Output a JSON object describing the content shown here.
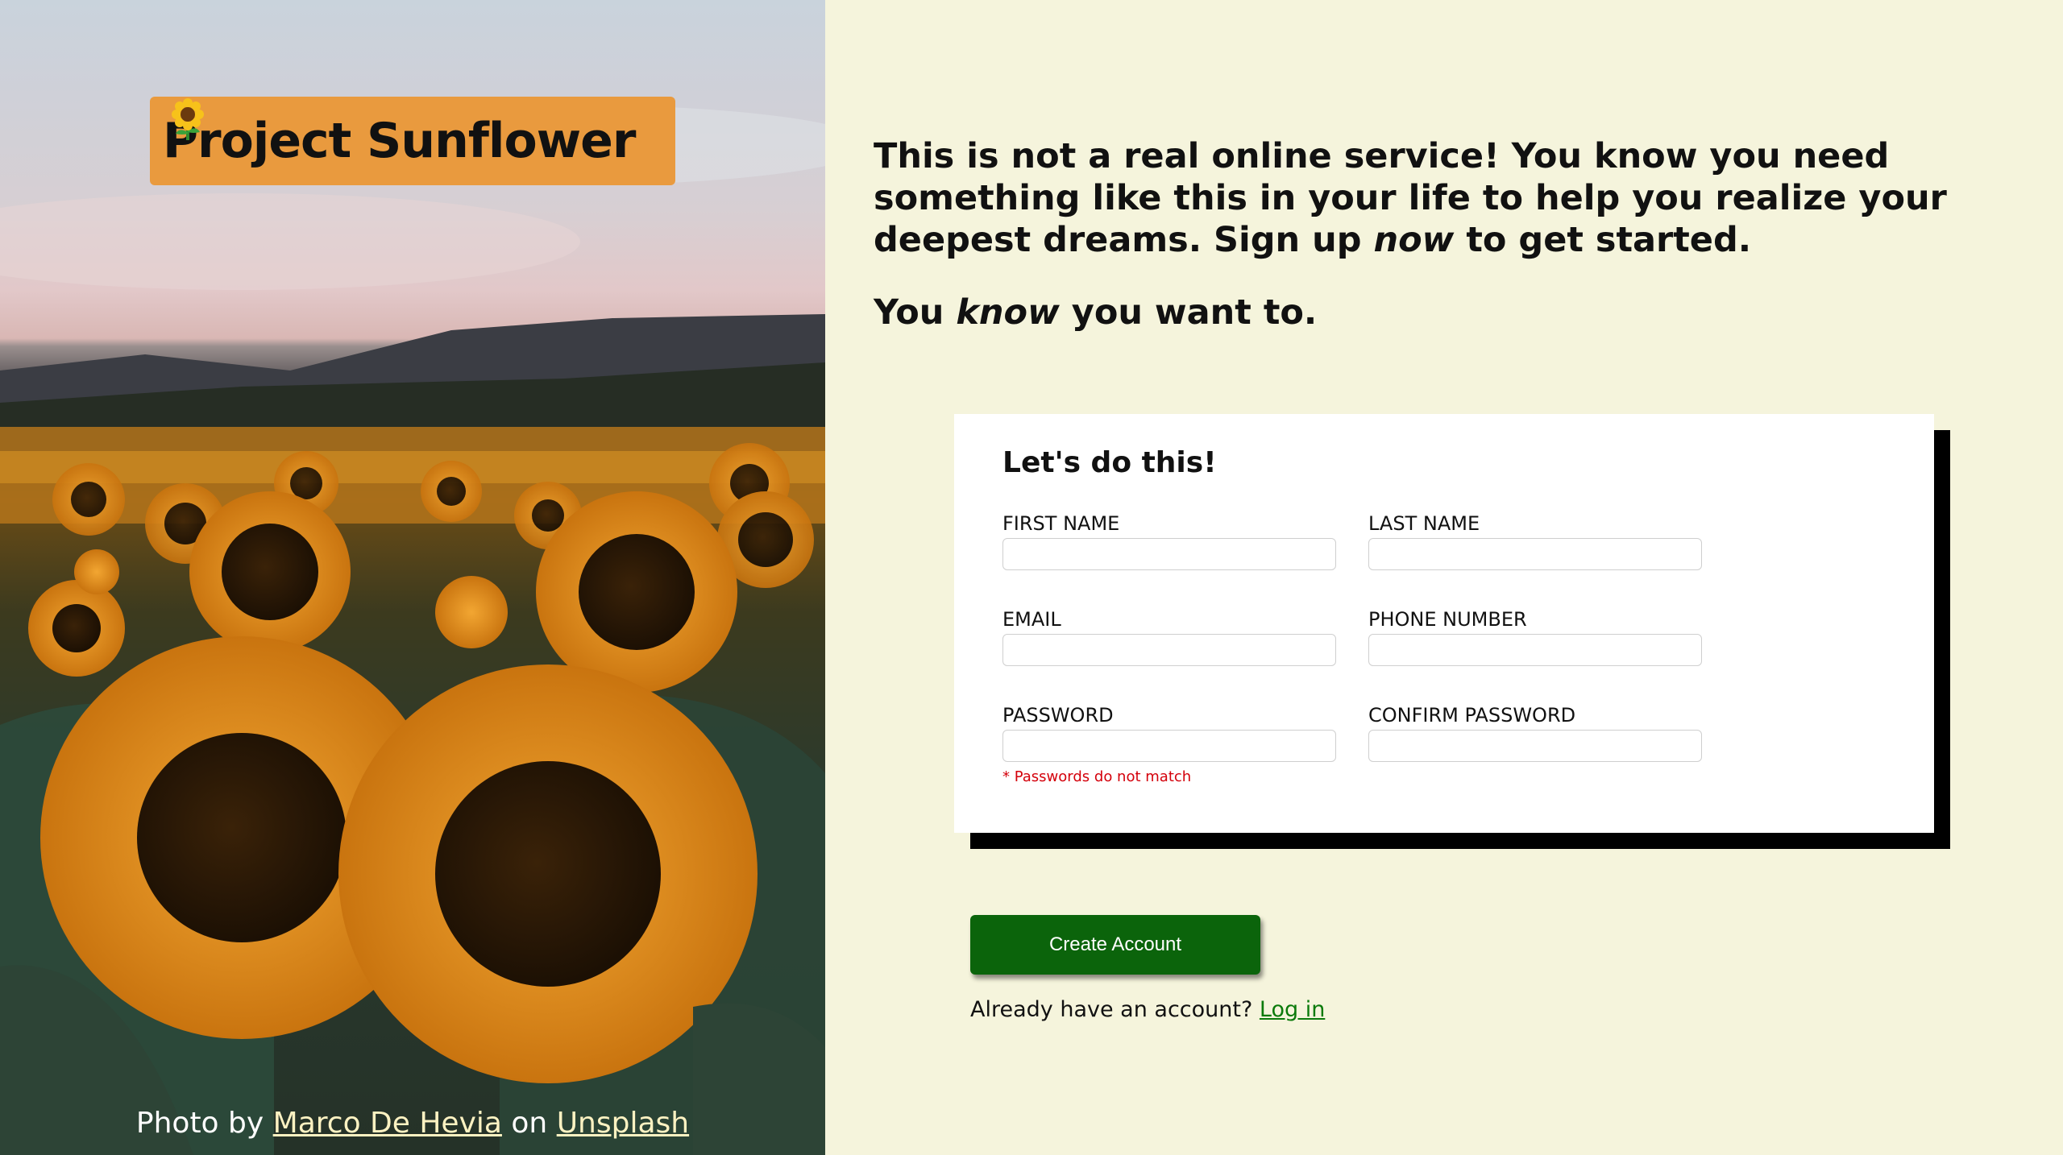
{
  "hero": {
    "logo_text": "Project Sunflower",
    "logo_icon": "sunflower-icon",
    "credit": {
      "prefix": "Photo by",
      "author": "Marco De Hevia",
      "middle": "on",
      "site": "Unsplash"
    }
  },
  "intro": {
    "line1_before": "This is not a real online service! You know you need something like this in your life to help you realize your deepest dreams. Sign up ",
    "line1_emph": "now",
    "line1_after": " to get started.",
    "line2_before": "You ",
    "line2_emph": "know",
    "line2_after": " you want to."
  },
  "form": {
    "title": "Let's do this!",
    "fields": {
      "first_name": {
        "label": "First Name",
        "value": ""
      },
      "last_name": {
        "label": "Last Name",
        "value": ""
      },
      "email": {
        "label": "Email",
        "value": ""
      },
      "phone": {
        "label": "Phone Number",
        "value": ""
      },
      "password": {
        "label": "Password",
        "value": ""
      },
      "confirm_password": {
        "label": "Confirm Password",
        "value": ""
      }
    },
    "error": "* Passwords do not match"
  },
  "actions": {
    "create_account": "Create Account",
    "login_prompt": "Already have an account?",
    "login_link": "Log in"
  },
  "colors": {
    "background": "#f5f4dc",
    "logo_bg": "#e99a3e",
    "button_bg": "#0b640b",
    "link": "#0b7a0b",
    "error": "#d4000b"
  }
}
